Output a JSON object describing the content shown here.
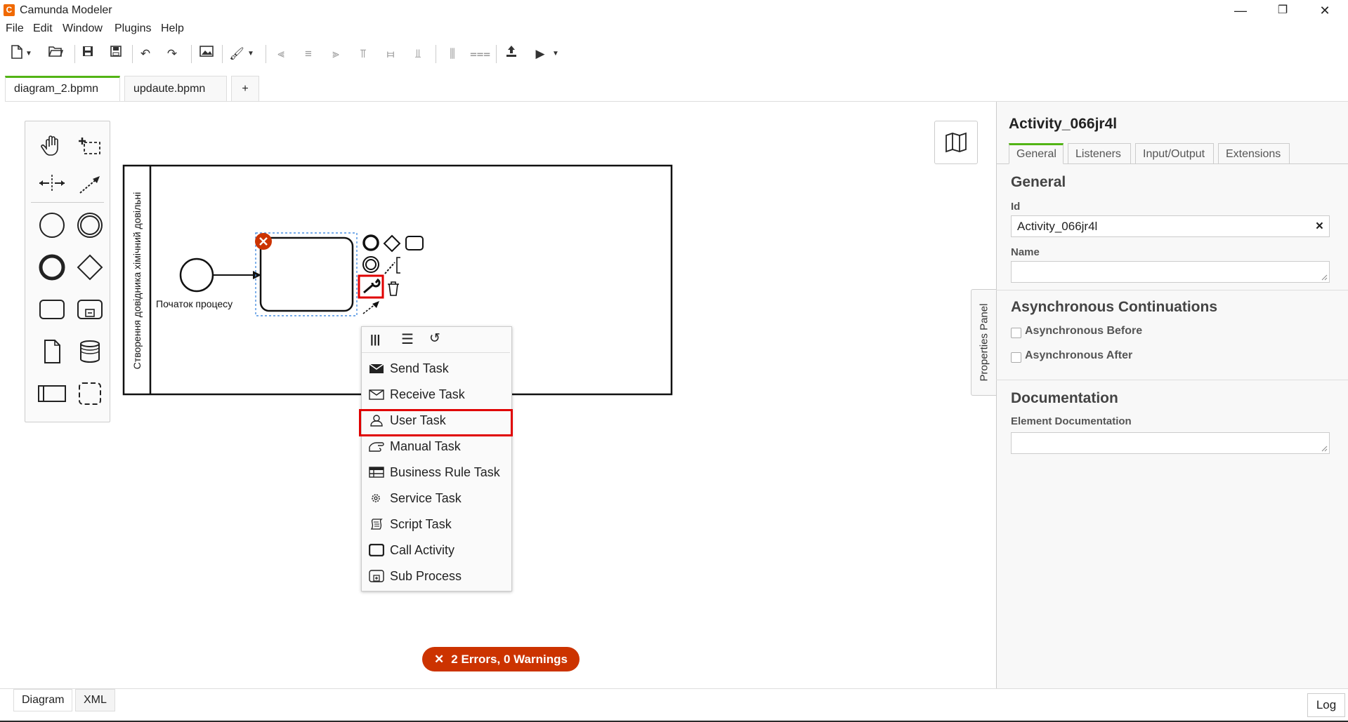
{
  "window": {
    "title": "Camunda Modeler",
    "controls": {
      "minimize": "—",
      "restore": "❐",
      "close": "✕"
    }
  },
  "menu": [
    "File",
    "Edit",
    "Window",
    "Plugins",
    "Help"
  ],
  "file_tabs": [
    {
      "label": "diagram_2.bpmn",
      "marker": "○",
      "active": true
    },
    {
      "label": "updaute.bpmn",
      "marker": "✕",
      "active": false
    }
  ],
  "add_tab_label": "+",
  "diagram": {
    "pool_label": "Створення довідника хімічний довільні",
    "start_event_label": "Початок процесу"
  },
  "replace_menu": {
    "items": [
      {
        "label": "Send Task",
        "icon": "send-task-icon"
      },
      {
        "label": "Receive Task",
        "icon": "receive-task-icon"
      },
      {
        "label": "User Task",
        "icon": "user-task-icon",
        "highlighted": true
      },
      {
        "label": "Manual Task",
        "icon": "manual-task-icon"
      },
      {
        "label": "Business Rule Task",
        "icon": "business-rule-task-icon"
      },
      {
        "label": "Service Task",
        "icon": "service-task-icon"
      },
      {
        "label": "Script Task",
        "icon": "script-task-icon"
      },
      {
        "label": "Call Activity",
        "icon": "call-activity-icon"
      },
      {
        "label": "Sub Process",
        "icon": "sub-process-icon"
      }
    ]
  },
  "status": {
    "errors_label": "2 Errors, 0 Warnings",
    "icon": "✕"
  },
  "properties": {
    "toggle_label": "Properties Panel",
    "element_id_title": "Activity_066jr4l",
    "tabs": [
      "General",
      "Listeners",
      "Input/Output",
      "Extensions"
    ],
    "general": {
      "heading": "General",
      "id_label": "Id",
      "id_value": "Activity_066jr4l",
      "clear": "×",
      "name_label": "Name",
      "name_value": ""
    },
    "async": {
      "heading": "Asynchronous Continuations",
      "before_label": "Asynchronous Before",
      "after_label": "Asynchronous After"
    },
    "documentation": {
      "heading": "Documentation",
      "field_label": "Element Documentation",
      "value": ""
    }
  },
  "bottom_tabs": [
    "Diagram",
    "XML"
  ],
  "log_label": "Log",
  "colors": {
    "accent": "#52b415",
    "error": "#cc3300",
    "highlight": "#e00000"
  }
}
